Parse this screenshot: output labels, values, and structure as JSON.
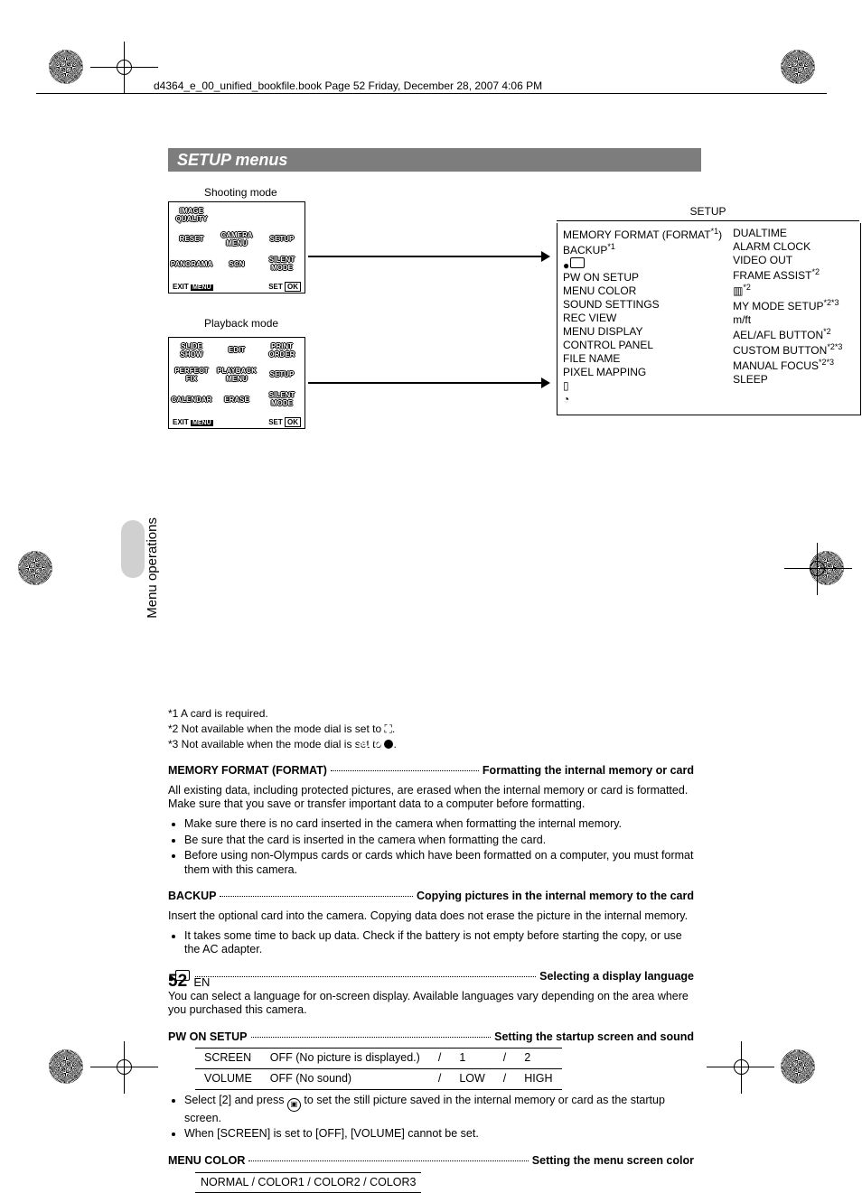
{
  "printheader": "d4364_e_00_unified_bookfile.book  Page 52  Friday, December 28, 2007  4:06 PM",
  "title": "SETUP menus",
  "shootmode_label": "Shooting mode",
  "playback_label": "Playback mode",
  "menubox_exit": "EXIT",
  "menubox_set": "SET",
  "menubox_ok": "OK",
  "menubox_menu": "MENU",
  "shoot_items": [
    "IMAGE QUALITY",
    "",
    "",
    "RESET",
    "CAMERA MENU",
    "SETUP",
    "PANORAMA",
    "SCN",
    "SILENT MODE"
  ],
  "play_items": [
    "SLIDE SHOW",
    "EDIT",
    "PRINT ORDER",
    "PERFECT FIX",
    "PLAYBACK MENU",
    "SETUP",
    "CALENDAR",
    "ERASE",
    "SILENT MODE"
  ],
  "setup_header": "SETUP",
  "setup_col1": [
    "MEMORY FORMAT (FORMAT<sup>*1</sup>)",
    "BACKUP<sup>*1</sup>",
    "<span class='lang-icon'></span>",
    "PW ON SETUP",
    "MENU COLOR",
    "SOUND SETTINGS",
    "REC VIEW",
    "MENU DISPLAY",
    "CONTROL PANEL",
    "FILE NAME",
    "PIXEL MAPPING",
    "▯",
    "◔"
  ],
  "setup_col2": [
    "DUALTIME",
    "ALARM CLOCK",
    "VIDEO OUT",
    "FRAME ASSIST<sup>*2</sup>",
    "▥<sup>*2</sup>",
    "MY MODE SETUP<sup>*2*3</sup>",
    "m/ft",
    "AEL/AFL BUTTON<sup>*2</sup>",
    "CUSTOM BUTTON<sup>*2*3</sup>",
    "MANUAL FOCUS<sup>*2*3</sup>",
    "SLEEP"
  ],
  "note1": "*1    A card is required.",
  "note2": "*2    Not available when the mode dial is set to ",
  "note2_icon": "⛶",
  "note3": "*3    Not available when the mode dial is set to ",
  "note3_icon": "AUTO",
  "mf_title": "MEMORY FORMAT (FORMAT)",
  "mf_desc": "Formatting the internal memory or card",
  "mf_body": "All existing data, including protected pictures, are erased when the internal memory or card is formatted. Make sure that you save or transfer important data to a computer before formatting.",
  "mf_bul": [
    "Make sure there is no card inserted in the camera when formatting the internal memory.",
    "Be sure that the card is inserted in the camera when formatting the card.",
    "Before using non-Olympus cards or cards which have been formatted on a computer, you must format them with this camera."
  ],
  "bk_title": "BACKUP",
  "bk_desc": "Copying pictures in the internal memory to the card",
  "bk_body": "Insert the optional card into the camera. Copying data does not erase the picture in the internal memory.",
  "bk_bul": [
    "It takes some time to back up data. Check if the battery is not empty before starting the copy, or use the AC adapter."
  ],
  "lang_title": "",
  "lang_desc": "Selecting a display language",
  "lang_body": "You can select a language for on-screen display. Available languages vary depending on the area where you purchased this camera.",
  "pw_title": "PW ON SETUP",
  "pw_desc": "Setting the startup screen and sound",
  "pw_rows": [
    [
      "SCREEN",
      "OFF (No picture is displayed.)",
      "/",
      "1",
      "/",
      "2"
    ],
    [
      "VOLUME",
      "OFF (No sound)",
      "/",
      "LOW",
      "/",
      "HIGH"
    ]
  ],
  "pw_bul_a": "Select [2] and press ",
  "pw_bul_a2": " to set the still picture saved in the internal memory or card as the startup screen.",
  "pw_bul_b": "When [SCREEN] is set to [OFF], [VOLUME] cannot be set.",
  "mc_title": "MENU COLOR",
  "mc_desc": "Setting the menu screen color",
  "mc_opts": "NORMAL    / COLOR1   / COLOR2   / COLOR3",
  "side": "Menu operations",
  "page": "52",
  "lang_code": "EN"
}
